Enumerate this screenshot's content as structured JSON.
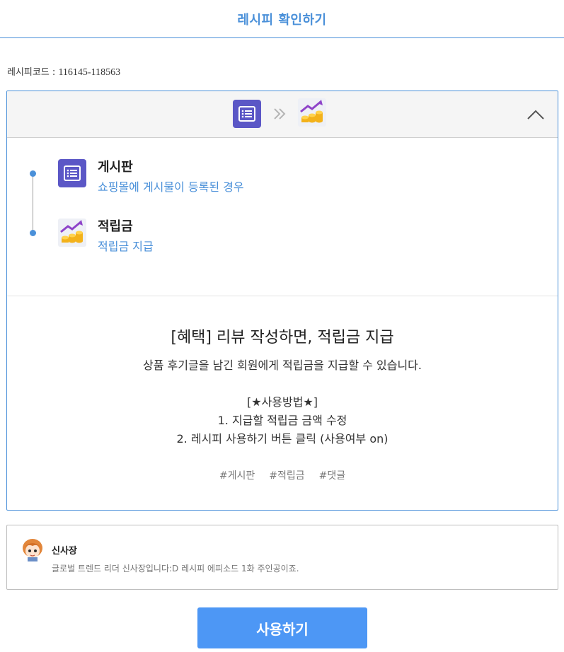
{
  "header": {
    "title": "레시피 확인하기"
  },
  "recipe": {
    "code_label": "레시피코드 : ",
    "code_value": "116145-118563"
  },
  "flow": {
    "trigger_icon": "board-list-icon",
    "arrow_icon": "double-chevron-right-icon",
    "action_icon": "coins-growth-icon",
    "collapse_icon": "chevron-up-icon"
  },
  "steps": [
    {
      "title": "게시판",
      "desc": "쇼핑몰에 게시물이 등록된 경우",
      "icon": "board-list-icon"
    },
    {
      "title": "적립금",
      "desc": "적립금 지급",
      "icon": "coins-growth-icon"
    }
  ],
  "description": {
    "title": "[혜택] 리뷰 작성하면, 적립금 지급",
    "line1": "상품 후기글을 남긴 회원에게 적립금을 지급할 수 있습니다.",
    "line2": "[★사용방법★]",
    "line3": "1. 지급할 적립금 금액 수정",
    "line4": "2. 레시피 사용하기 버튼 클릭 (사용여부 on)"
  },
  "tags": [
    "#게시판",
    "#적립금",
    "#댓글"
  ],
  "author": {
    "name": "신사장",
    "bio": "글로벌 트렌드 리더 신사장입니다:D 레시피 에피소드 1화 주인공이죠."
  },
  "actions": {
    "use_button": "사용하기"
  },
  "colors": {
    "accent": "#4a90d9",
    "button": "#4d97f5",
    "board_tile": "#5b57c6"
  }
}
